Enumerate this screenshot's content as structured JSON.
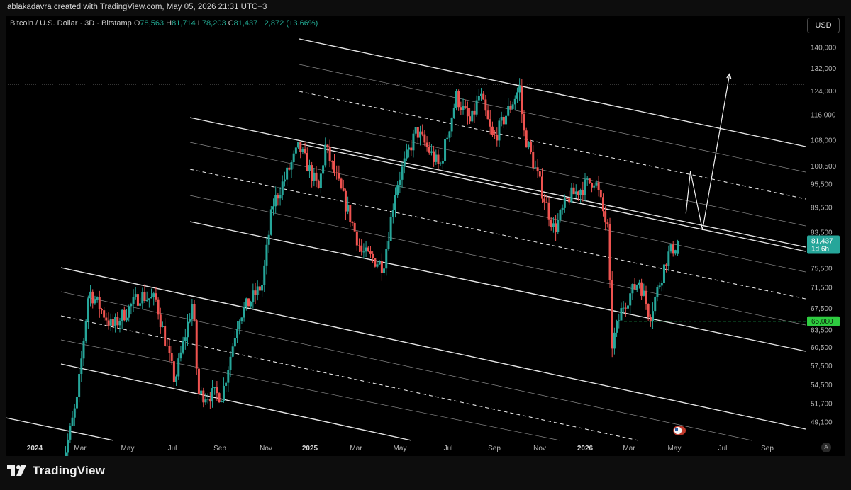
{
  "header": {
    "credit": "ablakadavra created with TradingView.com, May 05, 2026 21:31 UTC+3"
  },
  "legend": {
    "symbol": "Bitcoin / U.S. Dollar · 3D · Bitstamp",
    "open_label": "O",
    "open": "78,563",
    "high_label": "H",
    "high": "81,714",
    "low_label": "L",
    "low": "78,203",
    "close_label": "C",
    "close": "81,437",
    "change": "+2,872 (+3.66%)"
  },
  "currency": "USD",
  "price_badge": {
    "value": "81,437",
    "countdown": "1d 6h"
  },
  "support_badge": "65,080",
  "auto_button": "A",
  "brand": {
    "name": "TradingView"
  },
  "colors": {
    "up": "#26a69a",
    "down": "#ef5350",
    "channel": "#e6e6e6",
    "support": "#22c55e",
    "price_badge": "#26a69a",
    "support_badge": "#2ecc40"
  },
  "chart_data": {
    "type": "candlestick",
    "title": "Bitcoin / U.S. Dollar · 3D · Bitstamp",
    "y_ticks": [
      140000,
      132000,
      124000,
      116000,
      108000,
      100500,
      95500,
      89500,
      83500,
      75500,
      71500,
      67500,
      63500,
      60500,
      57500,
      54500,
      51700,
      49100
    ],
    "x_ticks": [
      "2024",
      "Mar",
      "May",
      "Jul",
      "Sep",
      "Nov",
      "2025",
      "Mar",
      "May",
      "Jul",
      "Sep",
      "Nov",
      "2026",
      "Mar",
      "May",
      "Jul",
      "Sep"
    ],
    "year_ticks": [
      "2024",
      "2025",
      "2026"
    ],
    "y_scale": "log",
    "last_price": 81437,
    "support_level": 65080,
    "ohlc_last": {
      "open": 78563,
      "high": 81714,
      "low": 78203,
      "close": 81437
    },
    "price_path": [
      [
        "2024-02-05",
        43000
      ],
      [
        "2024-02-26",
        52000
      ],
      [
        "2024-03-13",
        71000
      ],
      [
        "2024-04-13",
        64000
      ],
      [
        "2024-05-20",
        70000
      ],
      [
        "2024-06-10",
        69000
      ],
      [
        "2024-07-05",
        55000
      ],
      [
        "2024-07-29",
        69000
      ],
      [
        "2024-08-05",
        53000
      ],
      [
        "2024-09-06",
        53000
      ],
      [
        "2024-09-28",
        66000
      ],
      [
        "2024-10-29",
        72000
      ],
      [
        "2024-11-12",
        90000
      ],
      [
        "2024-12-17",
        106000
      ],
      [
        "2025-01-12",
        94000
      ],
      [
        "2025-01-21",
        106000
      ],
      [
        "2025-02-25",
        86000
      ],
      [
        "2025-03-10",
        79000
      ],
      [
        "2025-04-08",
        76000
      ],
      [
        "2025-04-25",
        95000
      ],
      [
        "2025-05-22",
        111000
      ],
      [
        "2025-06-22",
        100000
      ],
      [
        "2025-07-14",
        122000
      ],
      [
        "2025-08-02",
        113000
      ],
      [
        "2025-08-14",
        123000
      ],
      [
        "2025-09-01",
        108000
      ],
      [
        "2025-10-06",
        125000
      ],
      [
        "2025-10-11",
        111000
      ],
      [
        "2025-11-21",
        84000
      ],
      [
        "2025-12-10",
        92000
      ],
      [
        "2026-01-14",
        97000
      ],
      [
        "2026-01-31",
        84000
      ],
      [
        "2026-02-06",
        61000
      ],
      [
        "2026-02-20",
        68000
      ],
      [
        "2026-03-14",
        73000
      ],
      [
        "2026-03-28",
        66000
      ],
      [
        "2026-04-20",
        78000
      ],
      [
        "2026-05-05",
        81437
      ]
    ],
    "projection": [
      [
        "2026-05-15",
        88000
      ],
      [
        "2026-05-21",
        99000
      ],
      [
        "2026-06-06",
        84000
      ],
      [
        "2026-07-12",
        130000
      ]
    ]
  }
}
